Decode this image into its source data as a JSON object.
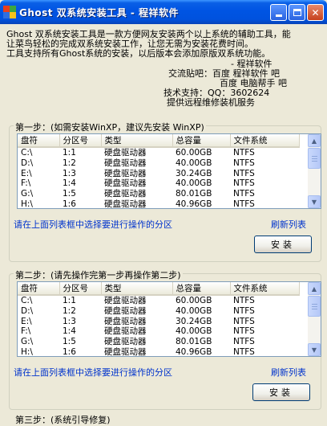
{
  "window": {
    "title": "Ghost 双系统安装工具 - 程祥软件",
    "minimize": "_",
    "maximize": "□",
    "close": "✕"
  },
  "intro": {
    "line1": "Ghost 双系统安装工具是一款方便网友安装两个以上系统的辅助工具，能",
    "line2": "让菜鸟轻松的完成双系统安装工作，让您无需为安装花费时间。",
    "line3": "工具支持所有Ghost系统的安装，以后版本会添加原版双系统功能。",
    "author": "- 程祥软件",
    "forum": "交流贴吧：百度 程祥软件 吧",
    "forum2": "百度 电脑帮手 吧",
    "support": "技术支持：QQ：3602624",
    "service": "提供远程维修装机服务"
  },
  "step1": {
    "legend": "第一步：(如需安装WinXP，建议先安装 WinXP)",
    "hint": "请在上面列表框中选择要进行操作的分区",
    "refresh": "刷新列表",
    "install": "安装"
  },
  "step2": {
    "legend": "第二步：(请先操作完第一步再操作第二步)",
    "hint": "请在上面列表框中选择要进行操作的分区",
    "refresh": "刷新列表",
    "install": "安装"
  },
  "step3": {
    "legend": "第三步：(系统引导修复)"
  },
  "columns": [
    "盘符",
    "分区号",
    "类型",
    "总容量",
    "文件系统"
  ],
  "rows": [
    [
      "C:\\",
      "1:1",
      "硬盘驱动器",
      "60.00GB",
      "NTFS"
    ],
    [
      "D:\\",
      "1:2",
      "硬盘驱动器",
      "40.00GB",
      "NTFS"
    ],
    [
      "E:\\",
      "1:3",
      "硬盘驱动器",
      "30.24GB",
      "NTFS"
    ],
    [
      "F:\\",
      "1:4",
      "硬盘驱动器",
      "40.00GB",
      "NTFS"
    ],
    [
      "G:\\",
      "1:5",
      "硬盘驱动器",
      "80.01GB",
      "NTFS"
    ],
    [
      "H:\\",
      "1:6",
      "硬盘驱动器",
      "40.96GB",
      "NTFS"
    ]
  ]
}
